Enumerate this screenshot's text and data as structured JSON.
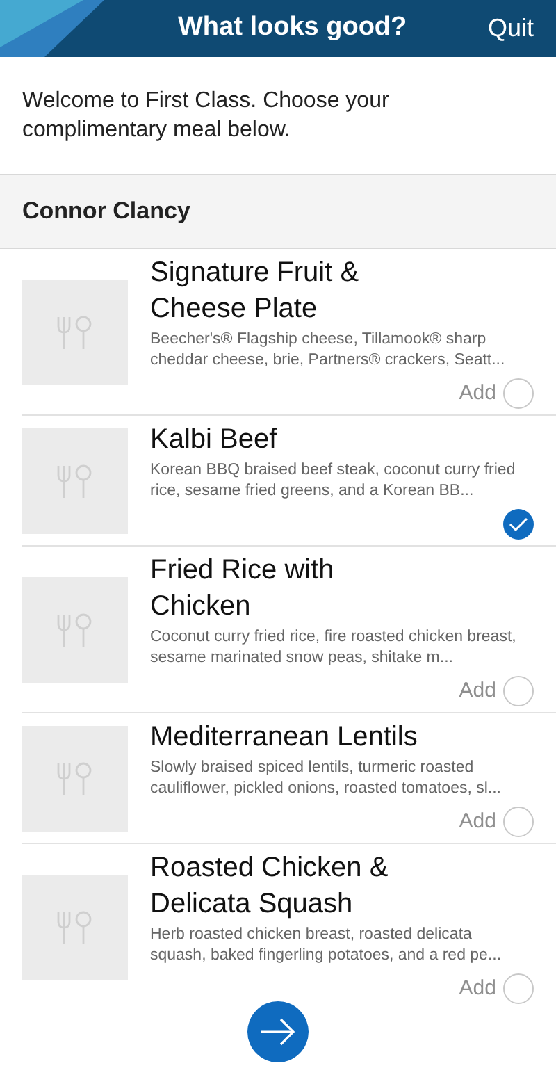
{
  "header": {
    "title": "What looks good?",
    "quit": "Quit"
  },
  "intro": "Welcome to First Class. Choose your complimentary meal below.",
  "passenger": "Connor Clancy",
  "meals": [
    {
      "name": "Signature Fruit & Cheese Plate",
      "description": "Beecher's® Flagship cheese, Tillamook® sharp cheddar cheese, brie, Partners® crackers, Seatt...",
      "add_label": "Add",
      "selected": false
    },
    {
      "name": "Kalbi Beef",
      "description": "Korean BBQ braised beef steak, coconut curry fried rice, sesame fried greens, and a Korean BB...",
      "selected": true
    },
    {
      "name": "Fried Rice with Chicken",
      "description": "Coconut curry fried rice, fire roasted chicken breast, sesame marinated snow peas, shitake m...",
      "add_label": "Add",
      "selected": false
    },
    {
      "name": "Mediterranean Lentils",
      "description": "Slowly braised spiced lentils, turmeric roasted cauliflower, pickled onions, roasted tomatoes, sl...",
      "add_label": "Add",
      "selected": false
    },
    {
      "name": "Roasted Chicken & Delicata Squash",
      "description": "Herb roasted chicken breast, roasted delicata squash, baked fingerling potatoes, and a red pe...",
      "add_label": "Add",
      "selected": false
    }
  ]
}
